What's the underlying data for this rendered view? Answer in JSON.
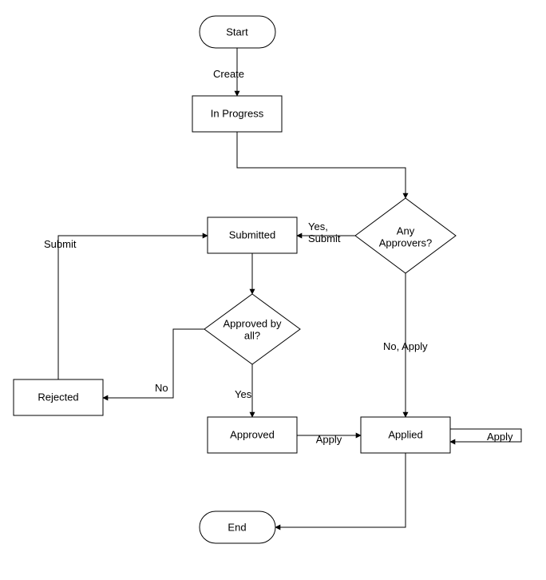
{
  "diagram": {
    "nodes": {
      "start": "Start",
      "in_progress": "In Progress",
      "any_approvers_l1": "Any",
      "any_approvers_l2": "Approvers?",
      "submitted": "Submitted",
      "approved_by_all_l1": "Approved by",
      "approved_by_all_l2": "all?",
      "rejected": "Rejected",
      "approved": "Approved",
      "applied": "Applied",
      "end": "End"
    },
    "edges": {
      "create": "Create",
      "yes_submit": "Yes, Submit",
      "no_apply": "No, Apply",
      "submit": "Submit",
      "no": "No",
      "yes": "Yes",
      "apply_inner": "Apply",
      "apply_loop": "Apply"
    }
  }
}
